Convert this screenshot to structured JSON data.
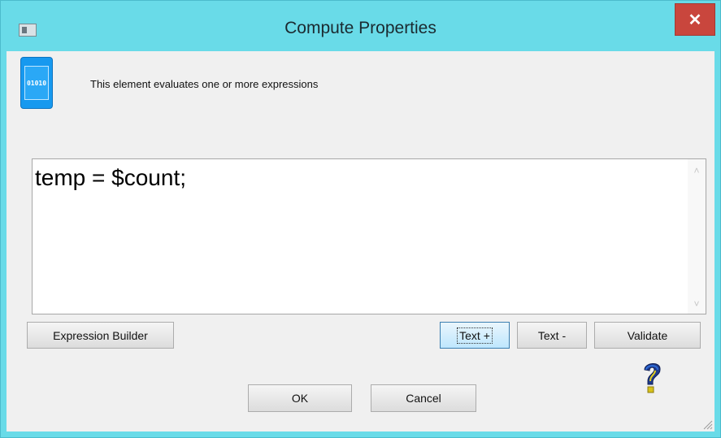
{
  "window": {
    "title": "Compute Properties",
    "close_label": "✕"
  },
  "header": {
    "icon_text": "01010",
    "description": "This element evaluates one or more expressions"
  },
  "editor": {
    "content": "temp = $count;"
  },
  "buttons": {
    "expression_builder": "Expression Builder",
    "text_plus": "Text +",
    "text_minus": "Text -",
    "validate": "Validate",
    "ok": "OK",
    "cancel": "Cancel"
  },
  "icons": {
    "app": "app-icon",
    "element": "binary-icon",
    "help": "help-question-icon",
    "close": "close-icon"
  },
  "colors": {
    "titlebar": "#69dbe8",
    "close_button": "#c9463d",
    "element_icon": "#1799ef",
    "focus_button": "#3c7fb1"
  }
}
